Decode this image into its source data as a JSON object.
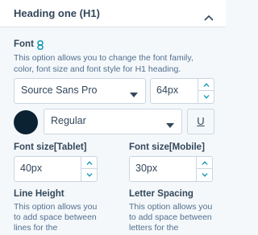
{
  "header": {
    "title": "Heading one (H1)",
    "toggle_icon": "chevron-up-icon"
  },
  "font": {
    "label": "Font",
    "link_icon": "link-icon",
    "help": "This option allows you to change the font family, color, font size and font style for H1 heading.",
    "family": "Source Sans Pro",
    "size": "64px",
    "color": "#0b2233",
    "style": "Regular",
    "underline_label": "U"
  },
  "tablet": {
    "label": "Font size[Tablet]",
    "value": "40px"
  },
  "mobile": {
    "label": "Font size[Mobile]",
    "value": "30px"
  },
  "line_height": {
    "label": "Line Height",
    "help": "This option allows you to add space between lines for the"
  },
  "letter_spacing": {
    "label": "Letter Spacing",
    "help": "This option allows you to add space between letters for the"
  },
  "colors": {
    "accent": "#0091ae",
    "text": "#33475b",
    "muted": "#516f90",
    "border": "#cbd6e2",
    "background": "#f5f8fa"
  }
}
